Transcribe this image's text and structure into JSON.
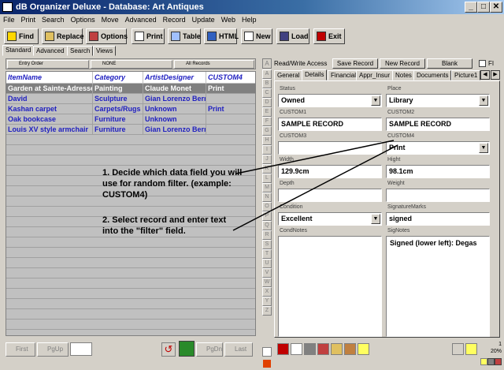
{
  "window": {
    "title": "dB Organizer Deluxe - Database: Art Antiques",
    "min": "_",
    "max": "□",
    "close": "✕"
  },
  "menu": [
    "File",
    "Print",
    "Search",
    "Options",
    "Move",
    "Advanced",
    "Record",
    "Update",
    "Web",
    "Help"
  ],
  "toolbar": {
    "find": "Find",
    "replace": "Replace",
    "options": "Options",
    "print": "Print",
    "table": "Table",
    "html": "HTML",
    "new": "New",
    "load": "Load",
    "exit": "Exit"
  },
  "view_tabs": [
    "Standard",
    "Advanced",
    "Search",
    "Views"
  ],
  "filters": {
    "order": "Entry Order",
    "filter": "NONE",
    "records": "All Records"
  },
  "grid": {
    "headers": [
      "ItemName",
      "Category",
      "ArtistDesigner",
      "CUSTOM4"
    ],
    "rows": [
      [
        "Garden at Sainte-Adresse",
        "Painting",
        "Claude Monet",
        "Print"
      ],
      [
        "David",
        "Sculpture",
        "Gian Lorenzo Bernini",
        ""
      ],
      [
        "Kashan carpet",
        "Carpets/Rugs",
        "Unknown",
        "Print"
      ],
      [
        "Oak bookcase",
        "Furniture",
        "Unknown",
        ""
      ],
      [
        "Louis XV style armchair",
        "Furniture",
        "Gian Lorenzo Bernini",
        ""
      ]
    ]
  },
  "nav": {
    "first": "First",
    "pgup": "PgUp",
    "pgdn": "PgDn",
    "last": "Last"
  },
  "alpha": [
    "A",
    "B",
    "C",
    "D",
    "E",
    "F",
    "G",
    "H",
    "I",
    "J",
    "K",
    "L",
    "M",
    "N",
    "O",
    "P",
    "Q",
    "R",
    "S",
    "T",
    "U",
    "V",
    "W",
    "X",
    "Y",
    "Z"
  ],
  "record_bar": {
    "access": "Read/Write Access",
    "save": "Save Record",
    "new": "New Record",
    "blank": "Blank",
    "fi": "FI"
  },
  "detail_tabs": [
    "General",
    "Details",
    "Financial",
    "Appr_Insur",
    "Notes",
    "Documents",
    "Picture1"
  ],
  "fields": {
    "status": {
      "label": "Status",
      "value": "Owned"
    },
    "place": {
      "label": "Place",
      "value": "Library"
    },
    "custom1": {
      "label": "CUSTOM1",
      "value": "SAMPLE RECORD"
    },
    "custom2": {
      "label": "CUSTOM2",
      "value": "SAMPLE RECORD"
    },
    "custom3": {
      "label": "CUSTOM3",
      "value": ""
    },
    "custom4": {
      "label": "CUSTOM4",
      "value": "Print"
    },
    "width": {
      "label": "Width",
      "value": "129.9cm"
    },
    "hight": {
      "label": "Hight",
      "value": "98.1cm"
    },
    "depth": {
      "label": "Depth",
      "value": ""
    },
    "weight": {
      "label": "Weight",
      "value": ""
    },
    "condition": {
      "label": "Condition",
      "value": "Excellent"
    },
    "signature": {
      "label": "SignatureMarks",
      "value": "signed"
    },
    "condnotes": {
      "label": "CondNotes",
      "value": ""
    },
    "signotes": {
      "label": "SigNotes",
      "value": "Signed (lower left): Degas"
    }
  },
  "callouts": {
    "one": "1. Decide which data field you will use for random filter. (example: CUSTOM4)",
    "two": "2. Select record and enter text into the \"filter\" field."
  },
  "status": {
    "count": "1",
    "percent": "20%"
  }
}
